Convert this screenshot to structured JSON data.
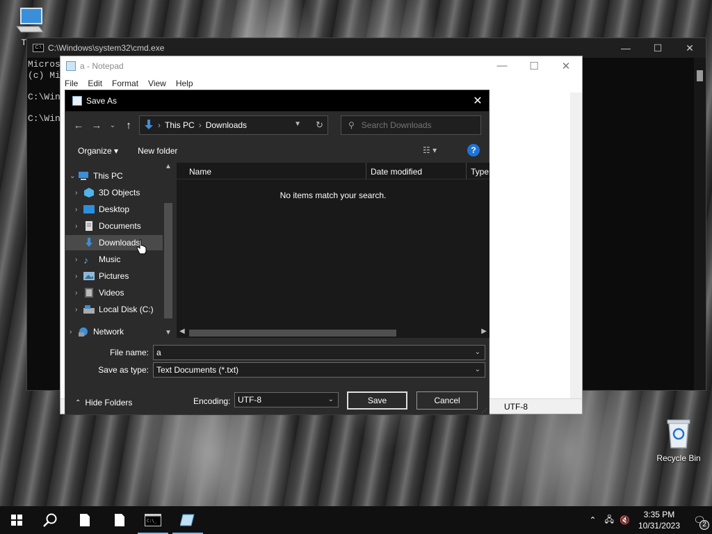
{
  "desktop": {
    "this_pc_label": "This",
    "recycle_bin_label": "Recycle Bin"
  },
  "cmd": {
    "title": "C:\\Windows\\system32\\cmd.exe",
    "text": "Micros\n(c) Mi\n\nC:\\Win\n\nC:\\Win",
    "controls": [
      "—",
      "☐",
      "✕"
    ]
  },
  "notepad": {
    "title": "a - Notepad",
    "menu": [
      "File",
      "Edit",
      "Format",
      "View",
      "Help"
    ],
    "encoding_status": "UTF-8",
    "controls": [
      "—",
      "☐",
      "✕"
    ]
  },
  "dialog": {
    "title": "Save As",
    "address": {
      "root": "This PC",
      "current": "Downloads"
    },
    "search_placeholder": "Search Downloads",
    "toolbar": {
      "organize": "Organize ▾",
      "new_folder": "New folder"
    },
    "tree": [
      {
        "label": "This PC",
        "level": 0,
        "expanded": true
      },
      {
        "label": "3D Objects",
        "level": 1
      },
      {
        "label": "Desktop",
        "level": 1
      },
      {
        "label": "Documents",
        "level": 1
      },
      {
        "label": "Downloads",
        "level": 1,
        "selected": true
      },
      {
        "label": "Music",
        "level": 1
      },
      {
        "label": "Pictures",
        "level": 1
      },
      {
        "label": "Videos",
        "level": 1
      },
      {
        "label": "Local Disk (C:)",
        "level": 1
      },
      {
        "label": "Network",
        "level": 0
      }
    ],
    "columns": [
      "Name",
      "Date modified",
      "Type"
    ],
    "empty_message": "No items match your search.",
    "file_name_label": "File name:",
    "file_name_value": "a",
    "save_as_type_label": "Save as type:",
    "save_as_type_value": "Text Documents (*.txt)",
    "hide_folders": "Hide Folders",
    "encoding_label": "Encoding:",
    "encoding_value": "UTF-8",
    "save": "Save",
    "cancel": "Cancel"
  },
  "taskbar": {
    "time": "3:35 PM",
    "date": "10/31/2023",
    "notification_count": "2"
  },
  "colors": {
    "dialog_bg": "#2b2b2b",
    "accent": "#76b9ed",
    "folder_blue": "#1e74d8"
  }
}
